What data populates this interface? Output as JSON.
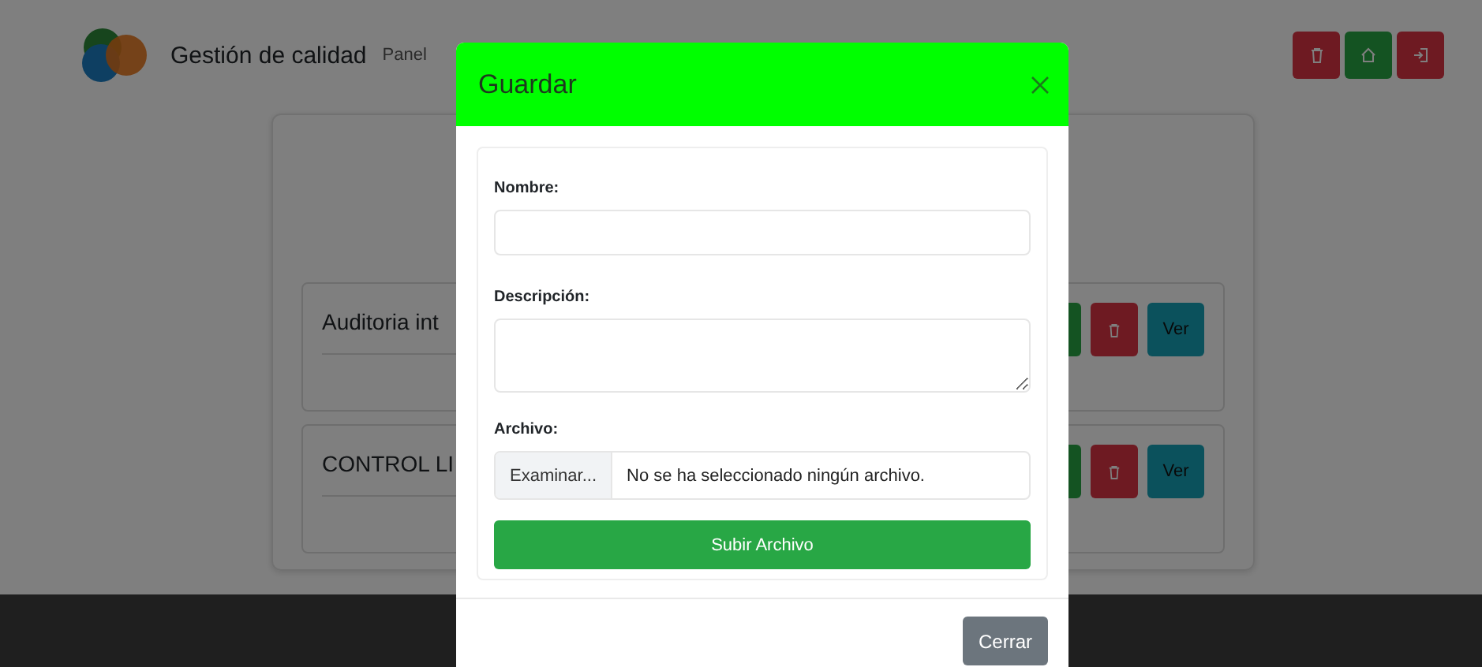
{
  "navbar": {
    "title": "Gestión de calidad",
    "subtitle": "Panel",
    "buttons": [
      {
        "kind": "delete"
      },
      {
        "kind": "home"
      },
      {
        "kind": "logout"
      }
    ]
  },
  "items": [
    {
      "title": "Auditoria int",
      "view_button": "Ver"
    },
    {
      "title": "CONTROL LI",
      "view_button": "Ver"
    }
  ],
  "modal": {
    "title": "Guardar",
    "fields": [
      {
        "kind": "text",
        "label": "Nombre:"
      },
      {
        "kind": "textarea",
        "label": "Descripción:"
      },
      {
        "kind": "file",
        "label": "Archivo:",
        "button": "Examinar...",
        "value": "No se ha seleccionado ningún archivo."
      }
    ],
    "submit_button": "Subir Archivo",
    "close_button": "Cerrar"
  }
}
